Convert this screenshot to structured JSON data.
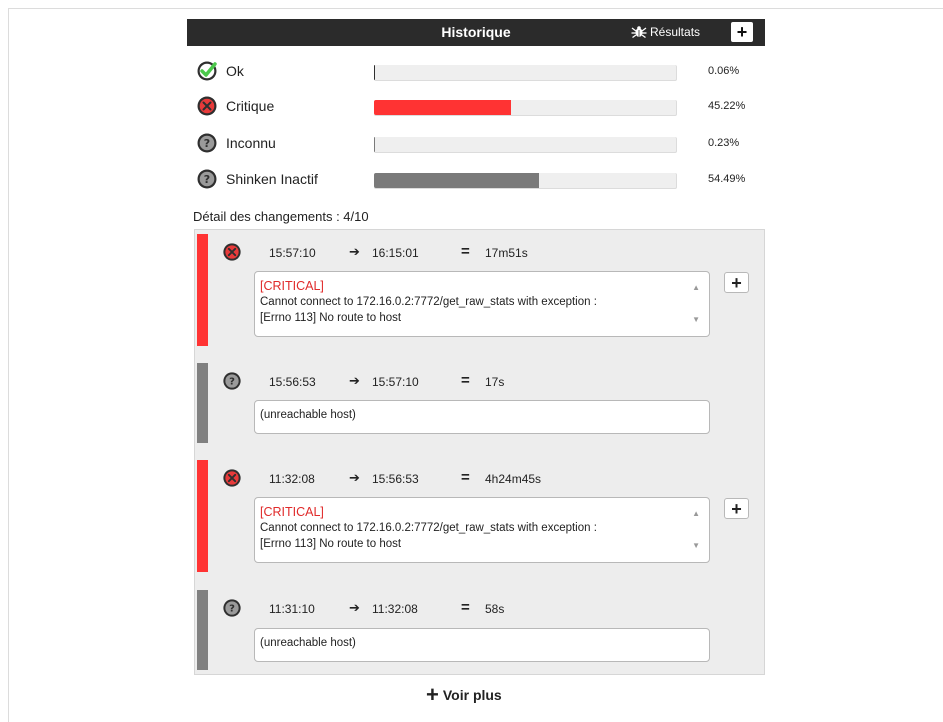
{
  "header": {
    "title": "Historique",
    "results_label": "Résultats",
    "add_label": "+"
  },
  "statuses": [
    {
      "label": "Ok",
      "percent_text": "0.06%",
      "percent": 0.06,
      "icon": "check-icon",
      "color": "#2f2f2f"
    },
    {
      "label": "Critique",
      "percent_text": "45.22%",
      "percent": 45.22,
      "icon": "critical-icon",
      "color": "#ff3333"
    },
    {
      "label": "Inconnu",
      "percent_text": "0.23%",
      "percent": 0.23,
      "icon": "unknown-icon",
      "color": "#7a7a7a"
    },
    {
      "label": "Shinken Inactif",
      "percent_text": "54.49%",
      "percent": 54.49,
      "icon": "inactive-icon",
      "color": "#7a7a7a"
    }
  ],
  "detail": {
    "title": "Détail des changements : 4/10"
  },
  "entries": [
    {
      "state": "critical",
      "start": "15:57:10",
      "end": "16:15:01",
      "duration": "17m51s",
      "output_title": "[CRITICAL]",
      "output_lines": [
        "Cannot connect to 172.16.0.2:7772/get_raw_stats with exception :",
        "[Errno 113] No route to host"
      ]
    },
    {
      "state": "unknown",
      "start": "15:56:53",
      "end": "15:57:10",
      "duration": "17s",
      "output_text": "(unreachable host)"
    },
    {
      "state": "critical",
      "start": "11:32:08",
      "end": "15:56:53",
      "duration": "4h24m45s",
      "output_title": "[CRITICAL]",
      "output_lines": [
        "Cannot connect to 172.16.0.2:7772/get_raw_stats with exception :",
        "[Errno 113] No route to host"
      ]
    },
    {
      "state": "unknown",
      "start": "11:31:10",
      "end": "11:32:08",
      "duration": "58s",
      "output_text": "(unreachable host)"
    }
  ],
  "symbols": {
    "arrow": "➔",
    "equals": "=",
    "plus": "+"
  },
  "footer": {
    "more_label": "Voir plus"
  },
  "colors": {
    "critical": "#ff3333",
    "unknown": "#808080",
    "header_bg": "#2b2b2b"
  }
}
